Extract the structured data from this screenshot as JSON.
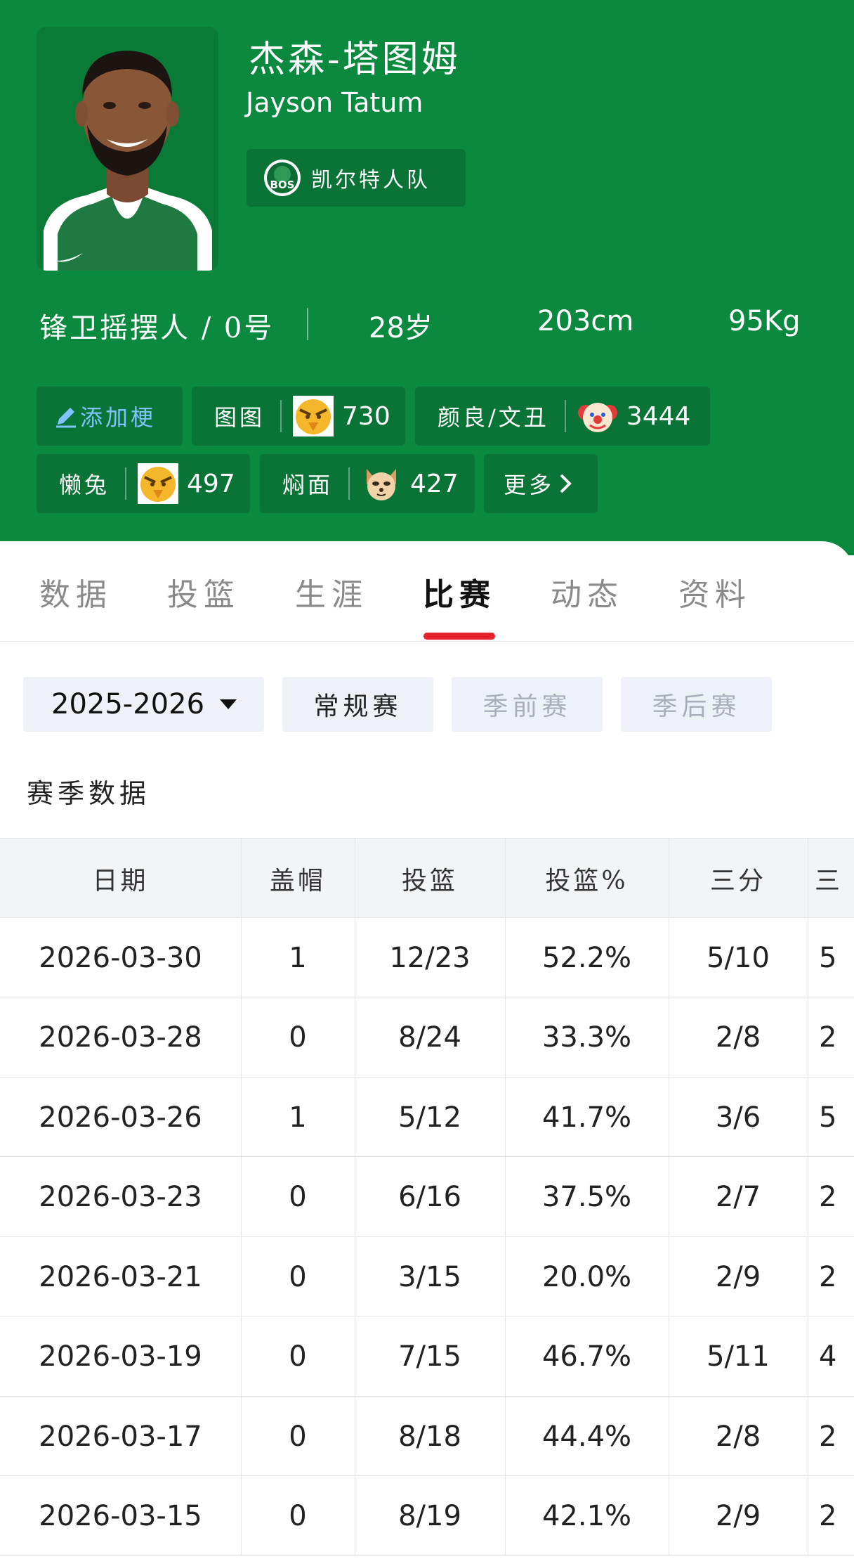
{
  "player": {
    "name_cn": "杰森-塔图姆",
    "name_en": "Jayson Tatum",
    "team": "凯尔特人队",
    "team_logo_text": "BOS",
    "position_number": "锋卫摇摆人 / 0号",
    "age": "28岁",
    "height": "203cm",
    "weight": "95Kg"
  },
  "nicknames": {
    "add_label": "添加梗",
    "items": [
      {
        "label": "图图",
        "count": "730",
        "emoji": "bird-face-icon"
      },
      {
        "label": "颜良/文丑",
        "count": "3444",
        "emoji": "clown-face-icon"
      },
      {
        "label": "懒兔",
        "count": "497",
        "emoji": "bird-face-icon"
      },
      {
        "label": "焖面",
        "count": "427",
        "emoji": "dog-face-icon"
      }
    ],
    "more_label": "更多"
  },
  "tabs": [
    "数据",
    "投篮",
    "生涯",
    "比赛",
    "动态",
    "资料"
  ],
  "active_tab": "比赛",
  "filters": {
    "season": "2025-2026",
    "types": [
      "常规赛",
      "季前赛",
      "季后赛"
    ],
    "selected_type": "常规赛"
  },
  "section_title": "赛季数据",
  "table": {
    "headers": [
      "日期",
      "盖帽",
      "投篮",
      "投篮%",
      "三分",
      "三"
    ],
    "rows": [
      [
        "2026-03-30",
        "1",
        "12/23",
        "52.2%",
        "5/10",
        "5"
      ],
      [
        "2026-03-28",
        "0",
        "8/24",
        "33.3%",
        "2/8",
        "2"
      ],
      [
        "2026-03-26",
        "1",
        "5/12",
        "41.7%",
        "3/6",
        "5"
      ],
      [
        "2026-03-23",
        "0",
        "6/16",
        "37.5%",
        "2/7",
        "2"
      ],
      [
        "2026-03-21",
        "0",
        "3/15",
        "20.0%",
        "2/9",
        "2"
      ],
      [
        "2026-03-19",
        "0",
        "7/15",
        "46.7%",
        "5/11",
        "4"
      ],
      [
        "2026-03-17",
        "0",
        "8/18",
        "44.4%",
        "2/8",
        "2"
      ],
      [
        "2026-03-15",
        "0",
        "8/19",
        "42.1%",
        "2/9",
        "2"
      ]
    ]
  },
  "colors": {
    "header_bg": "#0b8a3f",
    "chip_bg": "#0a7436",
    "tab_indicator": "#e5222c",
    "filter_bg": "#eef1f8",
    "add_tag_text": "#7fc3ff"
  }
}
